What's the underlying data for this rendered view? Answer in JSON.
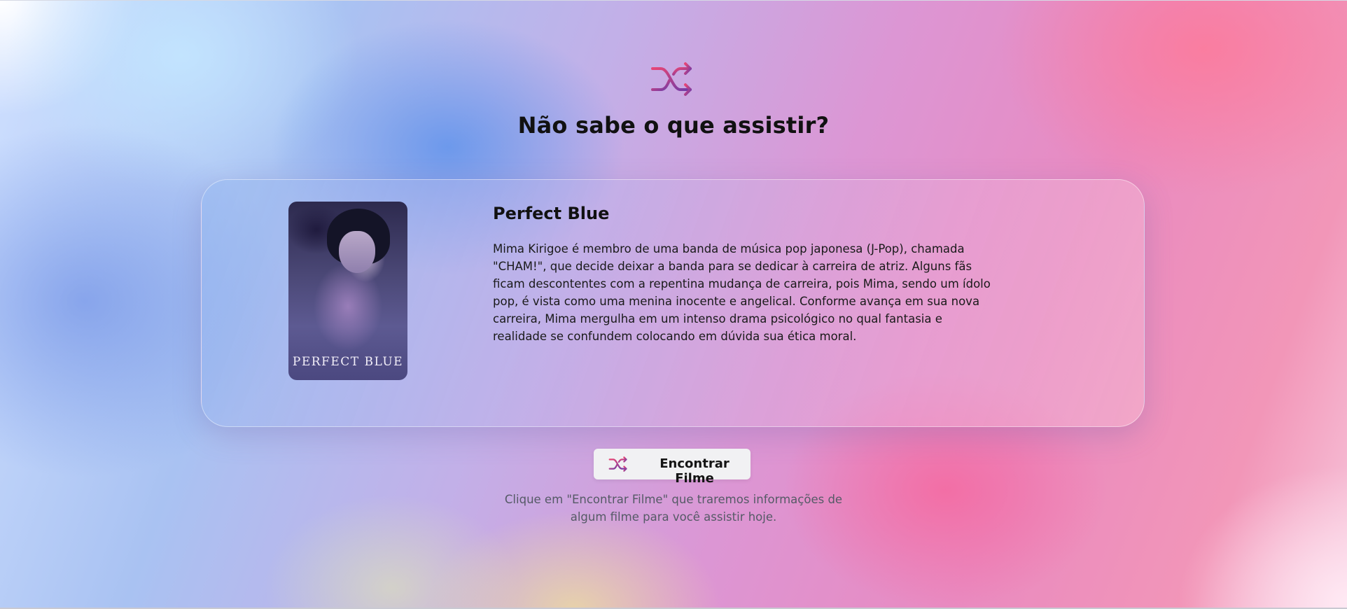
{
  "header": {
    "icon": "shuffle-icon",
    "title": "Não sabe o que assistir?"
  },
  "movie": {
    "poster_text": "PERFECT BLUE",
    "title": "Perfect Blue",
    "description": "Mima Kirigoe é membro de uma banda de música pop japonesa (J-Pop), chamada \"CHAM!\", que decide deixar a banda para se dedicar à carreira de atriz. Alguns fãs ficam descontentes com a repentina mudança de carreira, pois Mima, sendo um ídolo pop, é vista como uma menina inocente e angelical. Conforme avança em sua nova carreira, Mima mergulha em um intenso drama psicológico no qual fantasia e realidade se confundem colocando em dúvida sua ética moral."
  },
  "action": {
    "button_icon": "shuffle-icon",
    "button_label": "Encontrar Filme",
    "hint": "Clique em \"Encontrar Filme\" que traremos informações de algum filme para você assistir hoje."
  },
  "colors": {
    "icon_gradient_start": "#e0406f",
    "icon_gradient_end": "#7b3ea8",
    "title_text": "#111111",
    "button_bg": "#f1f1f3"
  }
}
